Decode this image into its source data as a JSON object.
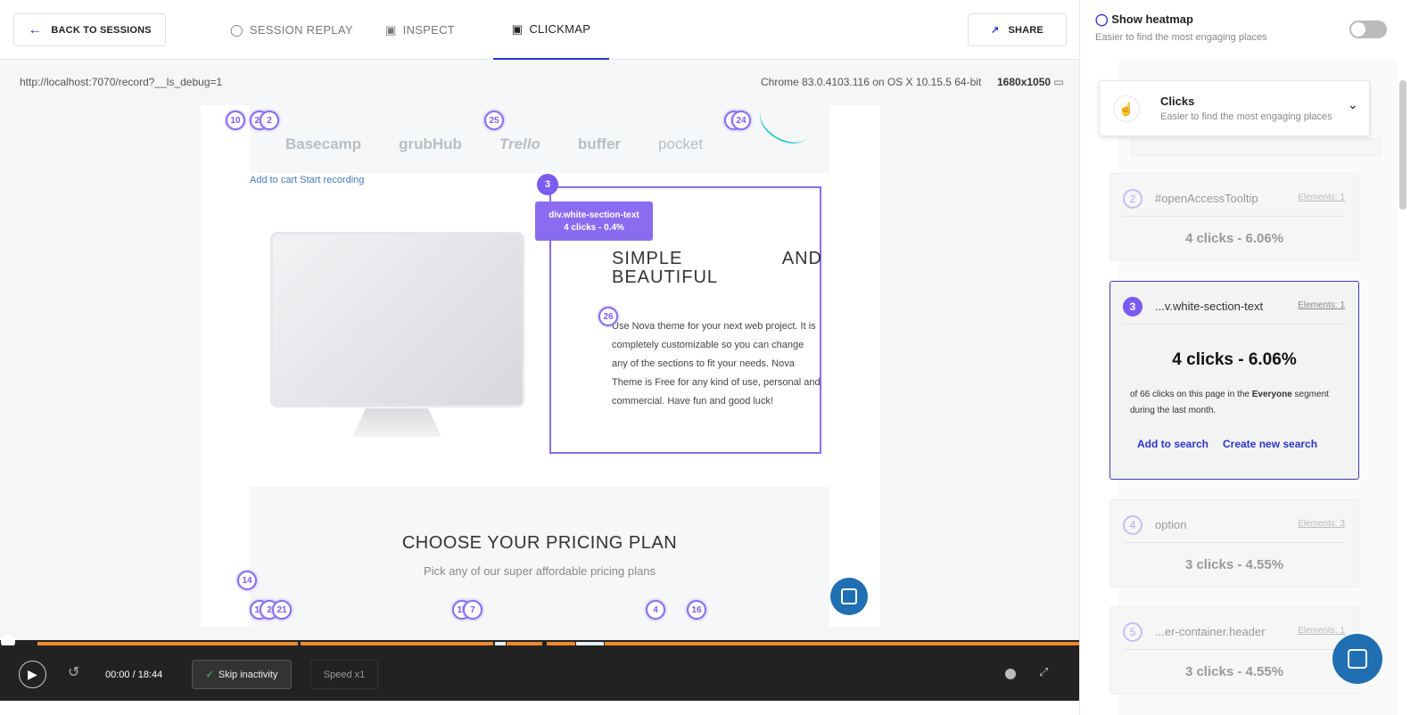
{
  "header": {
    "back_label": "BACK TO SESSIONS",
    "tabs": [
      {
        "label": "SESSION REPLAY",
        "icon": "play-circle-icon"
      },
      {
        "label": "INSPECT",
        "icon": "inspect-icon"
      },
      {
        "label": "CLICKMAP",
        "icon": "clickmap-icon",
        "active": true
      }
    ],
    "share_label": "SHARE"
  },
  "session": {
    "url": "http://localhost:7070/record?__ls_debug=1",
    "environment": "Chrome 83.0.4103.116 on OS X 10.15.5 64-bit",
    "resolution": "1680x1050"
  },
  "page": {
    "logos": [
      "Basecamp",
      "grubHub",
      "Trello",
      "buffer",
      "pocket"
    ],
    "cart_link": "Add to cart Start recording",
    "tooltip": {
      "badge": "3",
      "selector": "div.white-section-text",
      "stats": "4 clicks - 0.4%"
    },
    "heading_left": "SIMPLE",
    "heading_right": "AND",
    "heading_2": "BEAUTIFUL",
    "paragraph": "Use Nova theme for your next web project. It is completely customizable so you can change any of the sections to fit your needs. Nova Theme is Free for any kind of use, personal and commercial. Have fun and good luck!",
    "pricing_title": "CHOOSE YOUR PRICING PLAN",
    "pricing_subtitle": "Pick any of our super affordable pricing plans",
    "markers": [
      "10",
      "22",
      "2",
      "25",
      "2",
      "24",
      "26",
      "14",
      "19",
      "2",
      "21",
      "15",
      "7",
      "4",
      "16"
    ]
  },
  "player": {
    "time": "00:00 / 18:44",
    "skip_label": "Skip inactivity",
    "speed_label": "Speed x1",
    "accent": "#f0892b"
  },
  "sidebar": {
    "heatmap_title": "Show heatmap",
    "heatmap_subtitle": "Easier to find the most engaging places",
    "heatmap_on": false,
    "dropdown": {
      "title": "Clicks",
      "subtitle": "Easier to find the most engaging places"
    },
    "items": [
      {
        "num": "2",
        "name": "#openAccessTooltip",
        "elements": "Elements: 1",
        "clicks": "4 clicks - 6.06%"
      },
      {
        "num": "3",
        "name": "...v.white-section-text",
        "elements": "Elements: 1",
        "clicks": "4 clicks - 6.06%",
        "desc_pre": "of 66 clicks on this page in the ",
        "desc_bold": "Everyone",
        "desc_post": " segment during the last month.",
        "add_link": "Add to search",
        "create_link": "Create new search"
      },
      {
        "num": "4",
        "name": "option",
        "elements": "Elements: 3",
        "clicks": "3 clicks - 4.55%"
      },
      {
        "num": "5",
        "name": "...er-container.header",
        "elements": "Elements: 1",
        "clicks": "3 clicks - 4.55%"
      }
    ]
  },
  "colors": {
    "accent": "#7b5cf0",
    "primary": "#2d35c9",
    "chat": "#1f6fb2"
  }
}
